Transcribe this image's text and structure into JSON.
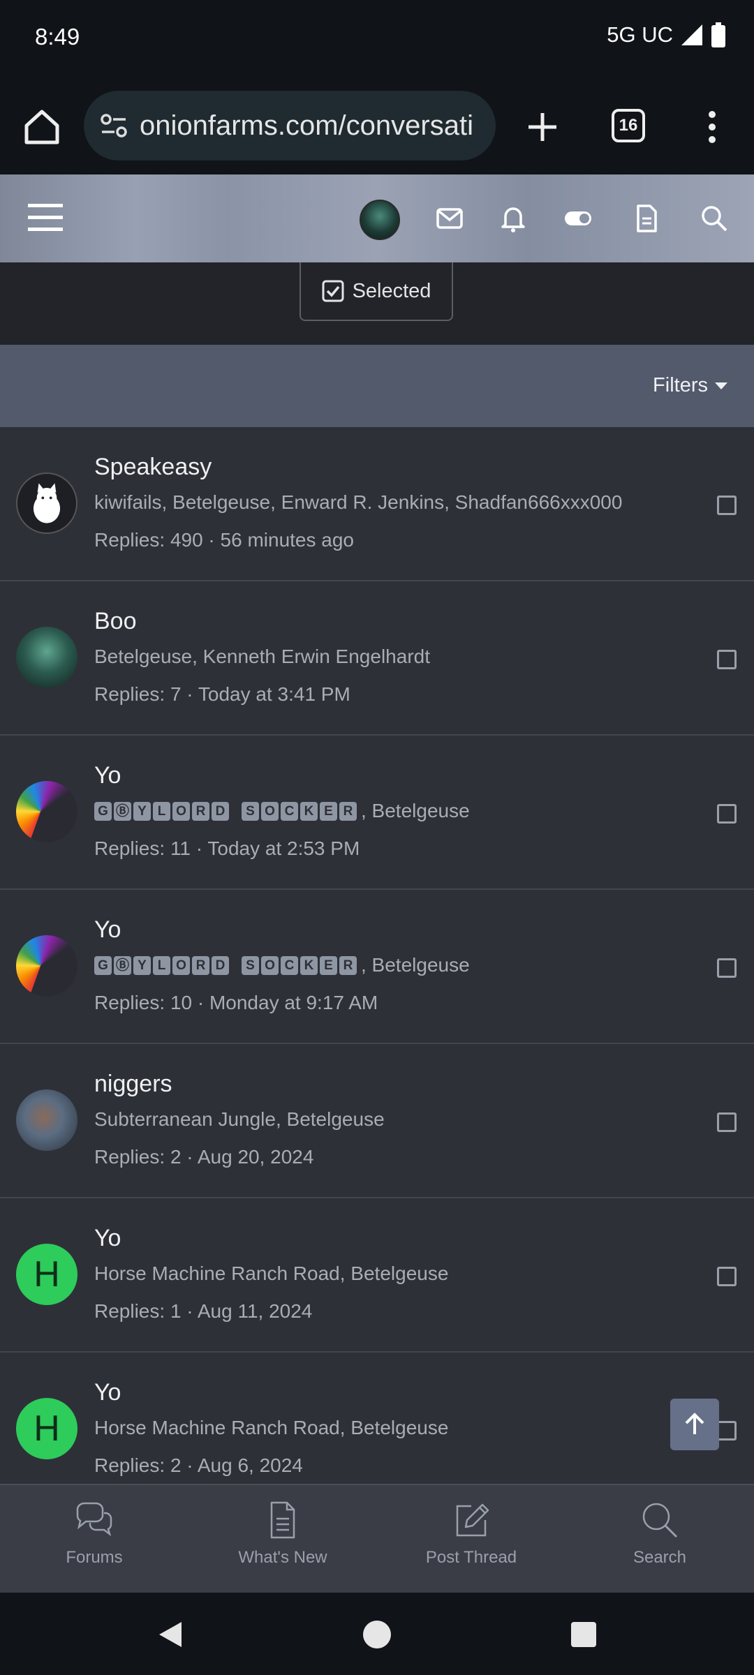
{
  "status": {
    "time": "8:49",
    "network": "5G UC"
  },
  "browser": {
    "url": "onionfarms.com/conversati",
    "tab_count": "16"
  },
  "toolbar": {
    "selected_label": "Selected",
    "filters_label": "Filters"
  },
  "conversations": [
    {
      "title": "Speakeasy",
      "participants": "kiwifails, Betelgeuse, Enward R. Jenkins, Shadfan666xxx000",
      "meta": "Replies: 490 · 56 minutes ago",
      "avatar": "cat-avatar"
    },
    {
      "title": "Boo",
      "participants": "Betelgeuse, Kenneth Erwin Engelhardt",
      "meta": "Replies: 7 · Today at 3:41 PM",
      "avatar": "ghoul-avatar"
    },
    {
      "title": "Yo",
      "participants_boxed_1": [
        "G",
        "Ⓑ",
        "Y",
        "L",
        "O",
        "R",
        "D"
      ],
      "participants_boxed_2": [
        "S",
        "O",
        "C",
        "K",
        "E",
        "R"
      ],
      "participants_suffix": ", Betelgeuse",
      "meta": "Replies: 11 · Today at 2:53 PM",
      "avatar": "rainbow-avatar"
    },
    {
      "title": "Yo",
      "participants_boxed_1": [
        "G",
        "Ⓑ",
        "Y",
        "L",
        "O",
        "R",
        "D"
      ],
      "participants_boxed_2": [
        "S",
        "O",
        "C",
        "K",
        "E",
        "R"
      ],
      "participants_suffix": ", Betelgeuse",
      "meta": "Replies: 10 · Monday at 9:17 AM",
      "avatar": "rainbow-avatar"
    },
    {
      "title": "niggers",
      "participants": "Subterranean Jungle, Betelgeuse",
      "meta": "Replies: 2 · Aug 20, 2024",
      "avatar": "painting-avatar"
    },
    {
      "title": "Yo",
      "participants": "Horse Machine Ranch Road, Betelgeuse",
      "meta": "Replies: 1 · Aug 11, 2024",
      "avatar": "letter-avatar",
      "avatar_letter": "H"
    },
    {
      "title": "Yo",
      "participants": "Horse Machine Ranch Road, Betelgeuse",
      "meta": "Replies: 2 · Aug 6, 2024",
      "avatar": "letter-avatar",
      "avatar_letter": "H"
    }
  ],
  "bottom_nav": [
    {
      "label": "Forums",
      "icon": "chat-bubbles-icon"
    },
    {
      "label": "What's New",
      "icon": "document-icon"
    },
    {
      "label": "Post Thread",
      "icon": "edit-icon"
    },
    {
      "label": "Search",
      "icon": "search-icon"
    }
  ],
  "colors": {
    "accent_green": "#2ecc5a",
    "filters_bar": "#525a6b"
  }
}
